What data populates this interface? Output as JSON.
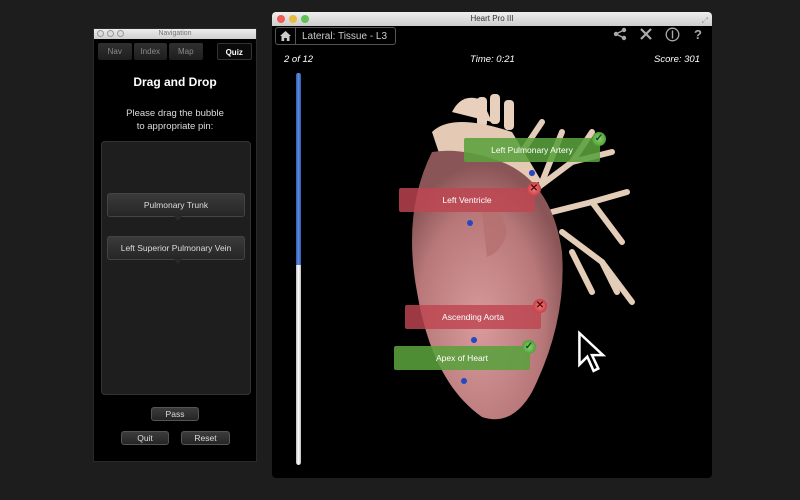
{
  "navigation": {
    "window_title": "Navigation",
    "tabs": [
      {
        "label": "Nav",
        "active": false
      },
      {
        "label": "Index",
        "active": false
      },
      {
        "label": "Map",
        "active": false
      },
      {
        "label": "Quiz",
        "active": true
      }
    ],
    "title": "Drag and Drop",
    "instruction_line1": "Please drag the bubble",
    "instruction_line2": "to appropriate pin:",
    "bubbles": [
      "Pulmonary Trunk",
      "Left Superior Pulmonary Vein"
    ],
    "buttons": {
      "pass": "Pass",
      "quit": "Quit",
      "reset": "Reset"
    }
  },
  "main": {
    "window_title": "Heart Pro III",
    "breadcrumb": "Lateral: Tissue - L3",
    "toolbar_icons": [
      "share-icon",
      "tools-icon",
      "info-icon",
      "help-icon"
    ],
    "progress_text": "2 of 12",
    "time": "Time: 0:21",
    "score": "Score: 301",
    "progress_fraction": 0.49,
    "labels": [
      {
        "text": "Left Pulmonary Artery",
        "status": "correct"
      },
      {
        "text": "Left Ventricle",
        "status": "wrong"
      },
      {
        "text": "Ascending Aorta",
        "status": "wrong"
      },
      {
        "text": "Apex of Heart",
        "status": "correct"
      }
    ]
  },
  "colors": {
    "correct": "#5aa03c",
    "wrong": "#be4650",
    "progress": "#4a7fd6",
    "pin": "#2547c0"
  }
}
